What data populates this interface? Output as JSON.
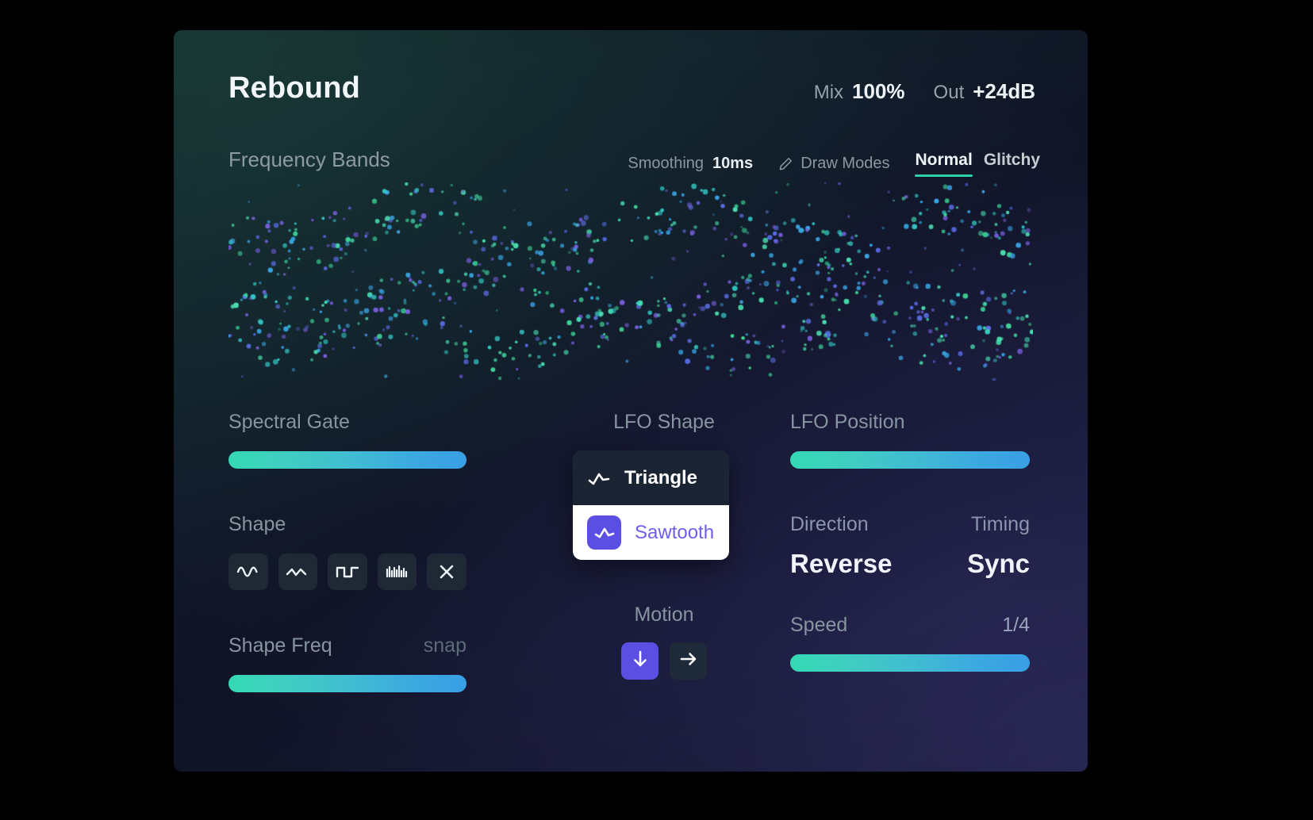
{
  "header": {
    "title": "Rebound",
    "mix_label": "Mix",
    "mix_value": "100%",
    "out_label": "Out",
    "out_value": "+24dB"
  },
  "section": {
    "label": "Frequency Bands",
    "smoothing_label": "Smoothing",
    "smoothing_value": "10ms",
    "draw_modes_label": "Draw Modes",
    "draw_modes_icon": "pencil-icon",
    "tabs": [
      {
        "label": "Normal",
        "active": true
      },
      {
        "label": "Glitchy",
        "active": false
      }
    ]
  },
  "visualizer": {
    "name": "frequency-bands-scatter",
    "dot_colors": [
      "#3fd99a",
      "#35c9c6",
      "#3aa8e8",
      "#5b6fe8",
      "#7a5fe0",
      "#49e0b0"
    ]
  },
  "left_column": {
    "spectral_gate_label": "Spectral Gate",
    "spectral_gate_fill_pct": 100,
    "shape_label": "Shape",
    "shape_buttons": [
      {
        "name": "sine-wave-icon",
        "active": false
      },
      {
        "name": "triangle-wave-icon",
        "active": false
      },
      {
        "name": "square-wave-icon",
        "active": false
      },
      {
        "name": "noise-wave-icon",
        "active": false
      },
      {
        "name": "close-x-icon",
        "active": false
      }
    ],
    "shape_freq_label": "Shape Freq",
    "shape_freq_snap_label": "snap",
    "shape_freq_fill_pct": 100
  },
  "center_column": {
    "lfo_shape_label": "LFO Shape",
    "lfo_options": [
      {
        "label": "Triangle",
        "icon": "triangle-wave-icon",
        "selected": false
      },
      {
        "label": "Sawtooth",
        "icon": "sawtooth-wave-icon",
        "selected": true
      }
    ],
    "motion_label": "Motion",
    "motion_buttons": [
      {
        "name": "arrow-down-icon",
        "active": true
      },
      {
        "name": "arrow-right-icon",
        "active": false
      }
    ]
  },
  "right_column": {
    "lfo_position_label": "LFO Position",
    "lfo_position_fill_pct": 100,
    "direction_label": "Direction",
    "direction_value": "Reverse",
    "timing_label": "Timing",
    "timing_value": "Sync",
    "speed_label": "Speed",
    "speed_value": "1/4",
    "speed_fill_pct": 100
  },
  "colors": {
    "accent_teal": "#2fcfa8",
    "accent_purple": "#5b4fe3",
    "slider_start": "#34d9b4",
    "slider_end": "#3a9fe6",
    "panel_dark": "#111528"
  }
}
